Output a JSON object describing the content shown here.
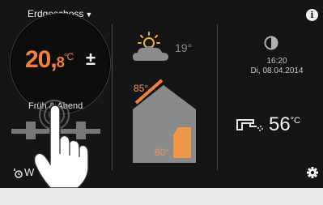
{
  "header": {
    "floor_label": "Erdgeschoss",
    "info_label": "i"
  },
  "room": {
    "temp_int": "20,",
    "temp_dec": "8",
    "unit": "°C",
    "plus_minus": "±",
    "schedule": "Früh & Abend"
  },
  "mode": {
    "label": "W"
  },
  "weather": {
    "temp": "19°"
  },
  "house": {
    "roof_temp": "85°",
    "floor_temp": "80°"
  },
  "clock": {
    "time": "16:20",
    "date": "Di, 08.04.2014"
  },
  "hot_water": {
    "temp": "56",
    "unit": "°C"
  },
  "colors": {
    "accent": "#f0803c",
    "background": "#151515"
  },
  "icons": [
    "chevron-down-icon",
    "info-icon",
    "sun-cloud-icon",
    "house-icon",
    "moon-icon",
    "shower-icon",
    "gear-icon",
    "clock-icon",
    "radiator-icon",
    "hand-pointer-icon"
  ]
}
